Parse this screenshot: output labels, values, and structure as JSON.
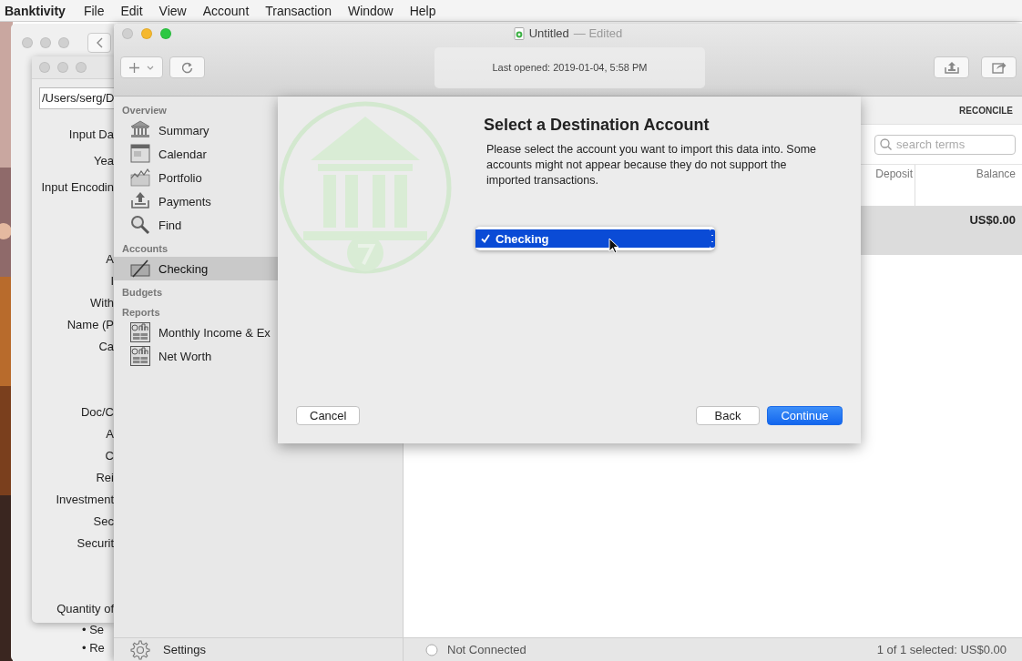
{
  "menu_bar": {
    "app": "Banktivity",
    "items": [
      "File",
      "Edit",
      "View",
      "Account",
      "Transaction",
      "Window",
      "Help"
    ]
  },
  "back_window": {
    "bullets": [
      "• Se",
      "• Re"
    ]
  },
  "import_window": {
    "path_field": "/Users/serg/D",
    "label_groups": [
      [
        "Input Da",
        "Yea",
        "Input Encodin"
      ],
      [
        "A",
        "I",
        "With",
        "Name (P",
        "Ca"
      ],
      [
        "Doc/C",
        "A",
        "C",
        "Rei",
        "Investment",
        "Sec",
        "Securit"
      ],
      [
        "Quantity of"
      ]
    ]
  },
  "main_window": {
    "title": "Untitled",
    "title_status": "— Edited",
    "last_opened": "Last opened: 2019-01-04, 5:58 PM",
    "sidebar": {
      "sections": [
        {
          "heading": "Overview",
          "items": [
            {
              "label": "Summary",
              "kind": "summary",
              "selected": false
            },
            {
              "label": "Calendar",
              "kind": "calendar",
              "selected": false
            },
            {
              "label": "Portfolio",
              "kind": "portfolio",
              "selected": false
            },
            {
              "label": "Payments",
              "kind": "payments",
              "selected": false
            },
            {
              "label": "Find",
              "kind": "find",
              "selected": false
            }
          ]
        },
        {
          "heading": "Accounts",
          "items": [
            {
              "label": "Checking",
              "kind": "account",
              "selected": true
            }
          ]
        },
        {
          "heading": "Budgets"
        },
        {
          "heading": "Reports",
          "items": [
            {
              "label": "Monthly Income & Ex",
              "kind": "report",
              "selected": false
            },
            {
              "label": "Net Worth",
              "kind": "report",
              "selected": false
            }
          ]
        }
      ],
      "settings": "Settings"
    },
    "register": {
      "action": "RECONCILE",
      "search_placeholder": "search terms",
      "columns": [
        "Deposit",
        "Balance"
      ],
      "rows": [
        {
          "balance": "US$0.00",
          "selected": true
        }
      ]
    },
    "status_bar": {
      "connection": "Not Connected",
      "summary": "1 of 1 selected: US$0.00"
    }
  },
  "dialog": {
    "title": "Select a Destination Account",
    "message": "Please select the account you want to import this data into. Some accounts might not appear because they do not support the imported transactions.",
    "popup": {
      "options": [
        {
          "label": "Checking",
          "selected": true
        }
      ]
    },
    "buttons": [
      {
        "label": "Cancel",
        "kind": "plain"
      },
      {
        "label": "Back",
        "kind": "plain"
      },
      {
        "label": "Continue",
        "kind": "default"
      }
    ]
  }
}
